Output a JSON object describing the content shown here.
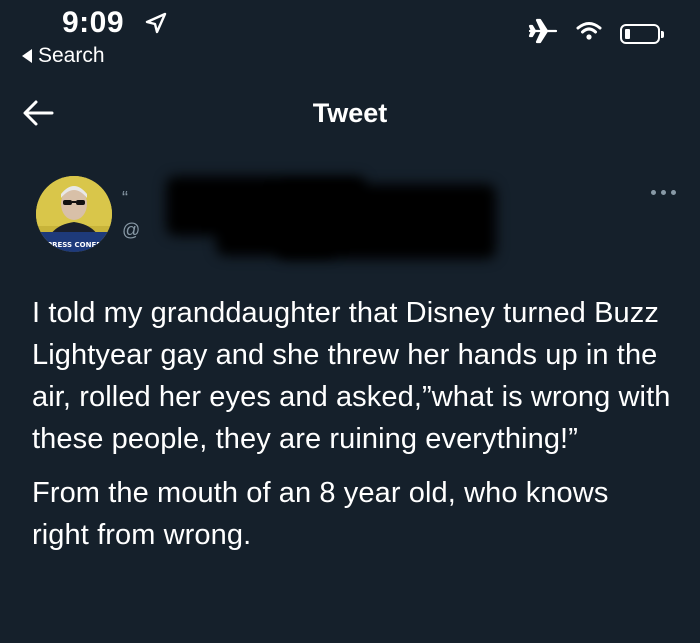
{
  "status_bar": {
    "time": "9:09",
    "back_to_app": "Search",
    "icons": [
      "location-arrow-icon",
      "airplane-icon",
      "wifi-icon",
      "battery-icon"
    ]
  },
  "nav": {
    "title": "Tweet",
    "back_icon": "arrow-left-icon"
  },
  "tweet": {
    "author": {
      "name_prefix": "“",
      "handle_prefix": "@",
      "avatar_caption": "PRESS CONFE"
    },
    "more_icon": "more-horizontal-icon",
    "paragraphs": [
      "I told my granddaughter that Disney turned Buzz Lightyear gay and she threw her hands up in the air, rolled her eyes and asked,”what is wrong with these people, they are ruining everything!”",
      "From the mouth of an 8 year old, who knows right from wrong."
    ]
  },
  "colors": {
    "background": "#15202b",
    "text": "#ffffff",
    "secondary": "#8899a6"
  }
}
